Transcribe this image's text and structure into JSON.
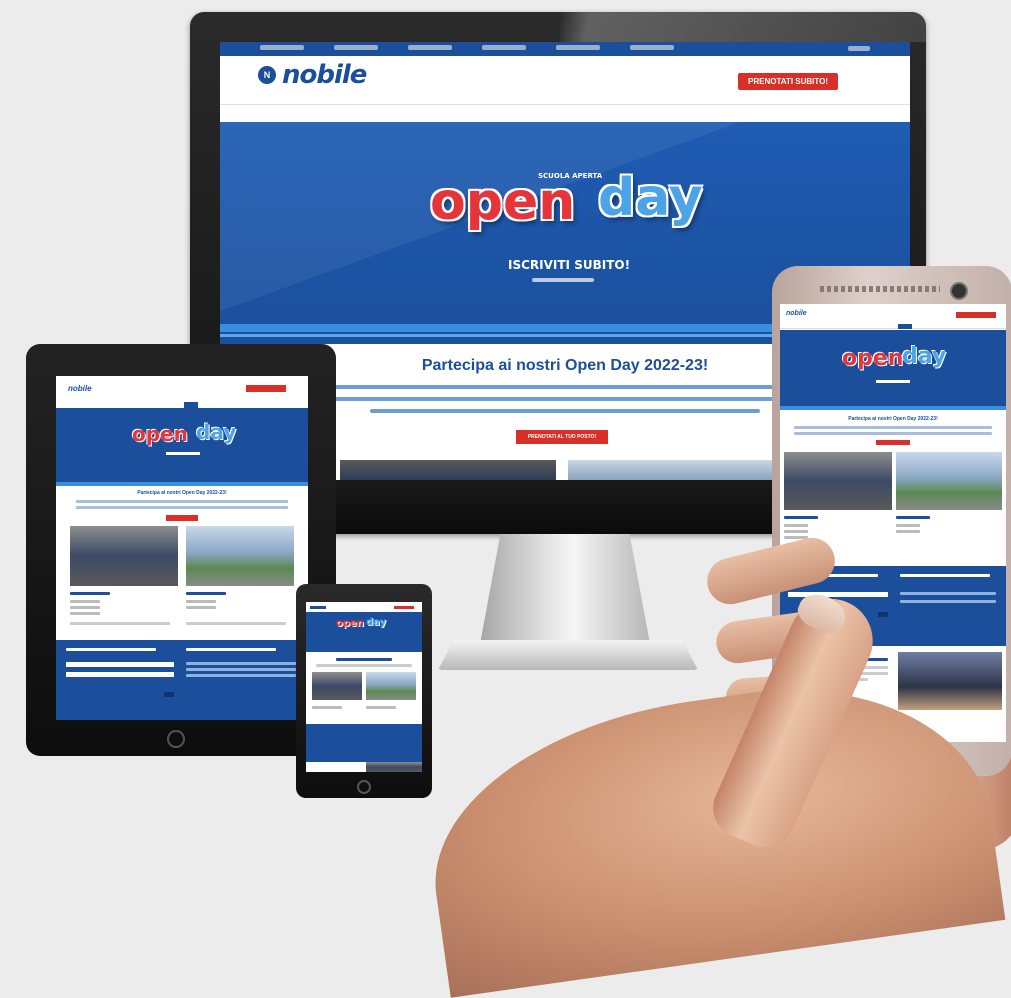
{
  "desktop": {
    "brand": "nobile",
    "cta_button": "PRENOTATI SUBITO!",
    "hero": {
      "kicker": "SCUOLA APERTA",
      "open_word": "open",
      "day_word": "day",
      "cta_text": "ISCRIVITI SUBITO!"
    },
    "section_title": "Partecipa ai nostri Open Day 2022-23!",
    "body_button": "PRENOTATI AL TUO POSTO!"
  },
  "tablet": {
    "brand": "nobile",
    "section_title": "Partecipa ai nostri Open Day 2022-23!",
    "open_word": "open",
    "day_word": "day"
  },
  "mini_tablet": {
    "open_word": "open",
    "day_word": "day"
  },
  "phone": {
    "brand": "nobile",
    "open_word": "open",
    "day_word": "day",
    "section_title": "Partecipa ai nostri Open Day 2022-23!"
  },
  "colors": {
    "brand_blue": "#1b4f9c",
    "accent_red": "#d73028",
    "sky_blue": "#4da3e8"
  }
}
